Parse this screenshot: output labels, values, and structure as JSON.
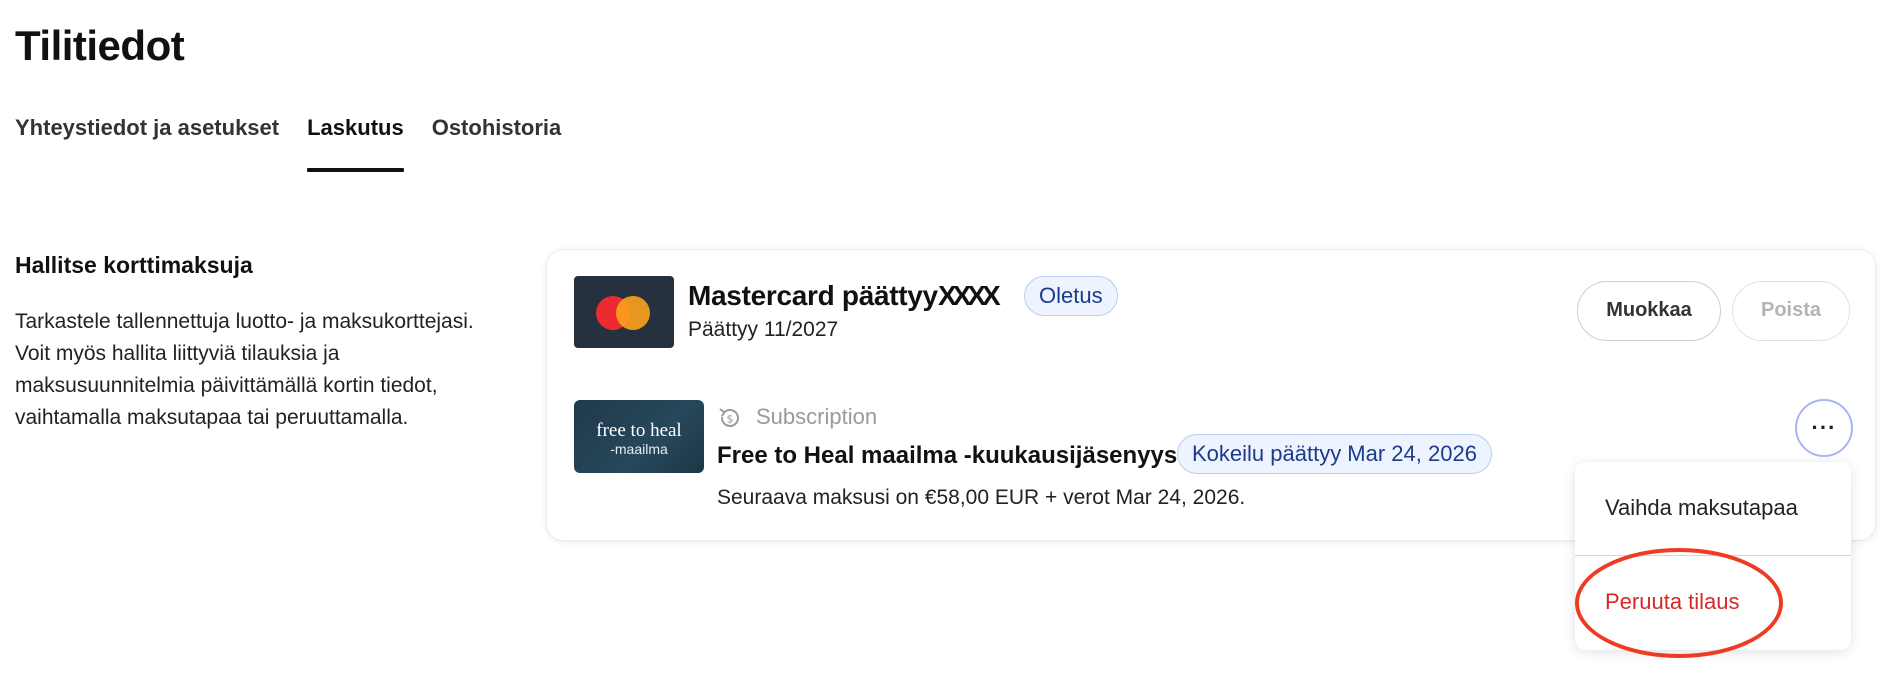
{
  "page": {
    "title": "Tilitiedot"
  },
  "tabs": [
    {
      "label": "Yhteystiedot ja asetukset",
      "active": false
    },
    {
      "label": "Laskutus",
      "active": true
    },
    {
      "label": "Ostohistoria",
      "active": false
    }
  ],
  "section": {
    "heading": "Hallitse korttimaksuja",
    "description": "Tarkastele tallennettuja luotto- ja maksukorttejasi. Voit myös hallita liittyviä tilauksia ja maksusuunnitelmia päivittämällä kortin tiedot, vaihtamalla maksutapaa tai peruuttamalla."
  },
  "card": {
    "brand_icon": "mastercard-icon",
    "title": "Mastercard päättyy",
    "masked_digits": "XXXX",
    "default_badge": "Oletus",
    "expiry": "Päättyy 11/2027",
    "edit_label": "Muokkaa",
    "delete_label": "Poista"
  },
  "subscription": {
    "thumb_line1": "free to heal",
    "thumb_line2": "-maailma",
    "type_icon": "recurring-payment-icon",
    "type": "Subscription",
    "title": "Free to Heal maailma -kuukausijäsenyys",
    "status_badge": "Kokeilu päättyy Mar 24, 2026",
    "next_payment": "Seuraava maksusi on €58,00 EUR + verot Mar 24, 2026.",
    "more_label": "···"
  },
  "menu": {
    "items": [
      {
        "label": "Vaihda maksutapaa",
        "color": "#222222"
      },
      {
        "label": "Peruuta tilaus",
        "color": "#d62828"
      }
    ]
  },
  "colors": {
    "accent_ring": "#ef3b24",
    "badge_bg": "#eef4ff",
    "badge_text": "#1e3a8a",
    "danger": "#d62828"
  }
}
